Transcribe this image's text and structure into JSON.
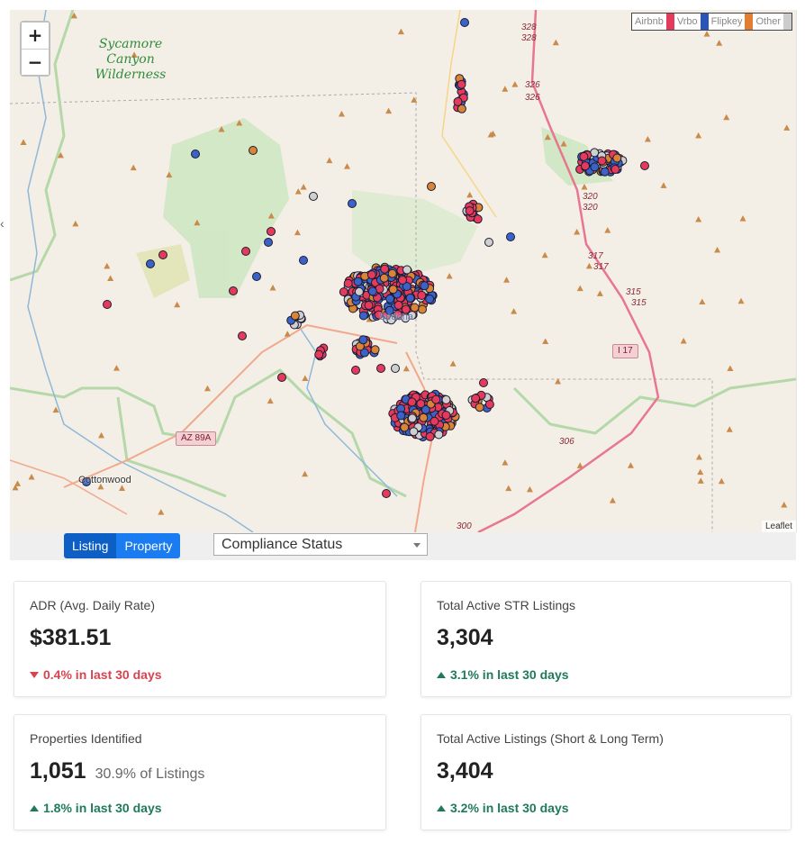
{
  "map": {
    "zoom_in": "+",
    "zoom_out": "−",
    "wilderness_label": "Sycamore Canyon Wilderness",
    "town_cottonwood": "Cottonwood",
    "town_sedona": "Sedona",
    "highway_az89a": "AZ 89A",
    "highway_i17": "I 17",
    "mile_markers": [
      "328",
      "328",
      "326",
      "326",
      "320",
      "320",
      "317",
      "317",
      "315",
      "315",
      "306",
      "300"
    ],
    "attribution": "Leaflet",
    "legend": [
      {
        "label": "Airbnb",
        "color": "#e63a5d"
      },
      {
        "label": "Vrbo",
        "color": "#2b54b8"
      },
      {
        "label": "Flipkey",
        "color": "#e27d32"
      },
      {
        "label": "Other",
        "color": "#cccccc"
      }
    ],
    "colors": {
      "airbnb": "#e63a5d",
      "vrbo": "#3b62c8",
      "flipkey": "#d98436",
      "other": "#cfcfcf"
    }
  },
  "toolbar": {
    "listing_label": "Listing",
    "property_label": "Property",
    "compliance_value": "Compliance Status"
  },
  "cards": {
    "adr": {
      "label": "ADR (Avg. Daily Rate)",
      "value": "$381.51",
      "delta": "0.4% in last 30 days"
    },
    "str": {
      "label": "Total Active STR Listings",
      "value": "3,304",
      "delta": "3.1% in last 30 days"
    },
    "props": {
      "label": "Properties Identified",
      "value": "1,051",
      "sub": "30.9% of Listings",
      "delta": "1.8% in last 30 days"
    },
    "total": {
      "label": "Total Active Listings (Short & Long Term)",
      "value": "3,404",
      "delta": "3.2% in last 30 days"
    }
  }
}
